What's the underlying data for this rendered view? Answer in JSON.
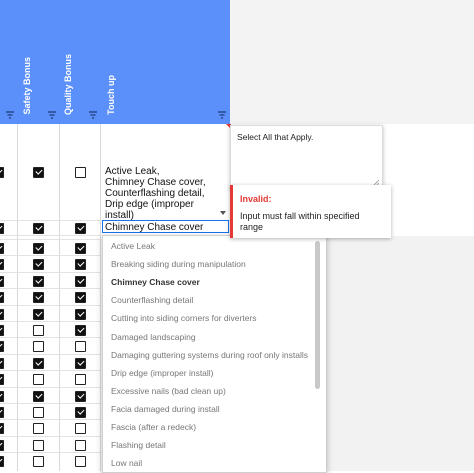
{
  "header": {
    "columns": [
      "Safety Bonus",
      "Quality Bonus",
      "Touch up"
    ],
    "filter_icon": "filter-icon",
    "header_color": "#5b8ff9"
  },
  "touch_up_cell": {
    "text": "Active Leak,\nChimney Chase cover,\nCounterflashing detail,\nDrip edge (improper\ninstall)",
    "safety_checked": true,
    "quality_checked": false
  },
  "edit_cell": {
    "value": "Chimney Chase cover"
  },
  "rows": [
    {
      "safety": true,
      "quality": true
    },
    {
      "safety": true,
      "quality": true
    },
    {
      "safety": true,
      "quality": true
    },
    {
      "safety": true,
      "quality": true
    },
    {
      "safety": true,
      "quality": true
    },
    {
      "safety": false,
      "quality": true
    },
    {
      "safety": false,
      "quality": false
    },
    {
      "safety": true,
      "quality": true
    },
    {
      "safety": false,
      "quality": false
    },
    {
      "safety": true,
      "quality": true
    },
    {
      "safety": false,
      "quality": true
    },
    {
      "safety": false,
      "quality": false
    },
    {
      "safety": false,
      "quality": false
    },
    {
      "safety": false,
      "quality": false
    },
    {
      "safety": false,
      "quality": true
    }
  ],
  "dropdown": {
    "options": [
      "Active Leak",
      "Breaking siding during manipulation",
      "Chimney Chase cover",
      "Counterflashing detail",
      "Cutting into siding corners for diverters",
      "Damaged landscaping",
      "Damaging guttering systems during roof only installs",
      "Drip edge (improper install)",
      "Excessive nails (bad clean up)",
      "Facia damaged during install",
      "Fascia (after a redeck)",
      "Flashing detail",
      "Low nail"
    ],
    "selected_index": 2
  },
  "note": {
    "text": "Select All that Apply."
  },
  "error": {
    "title": "Invalid:",
    "message": "Input must fall within specified range",
    "accent": "#e53935"
  }
}
